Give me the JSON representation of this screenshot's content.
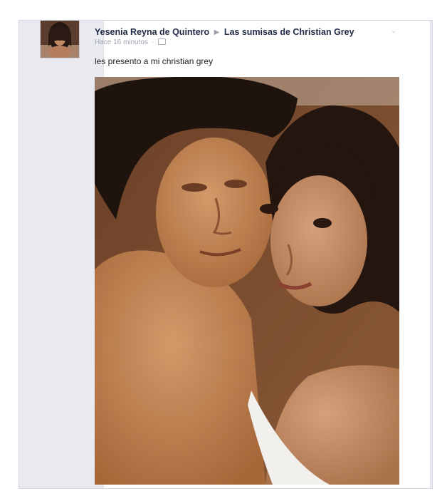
{
  "post": {
    "author": "Yesenia Reyna de Quintero",
    "group": "Las sumisas de Christian Grey",
    "timestamp": "Hace 16 minutos",
    "meta_separator": "·",
    "text": "les presento a mi christian grey"
  },
  "icons": {
    "share_arrow": "triangle-right-icon",
    "audience": "audience-icon",
    "options": "chevron-down-icon"
  },
  "colors": {
    "author_text": "#1f2b46",
    "meta_text": "#9ea3ad",
    "frame_background": "#e9ebf1"
  }
}
